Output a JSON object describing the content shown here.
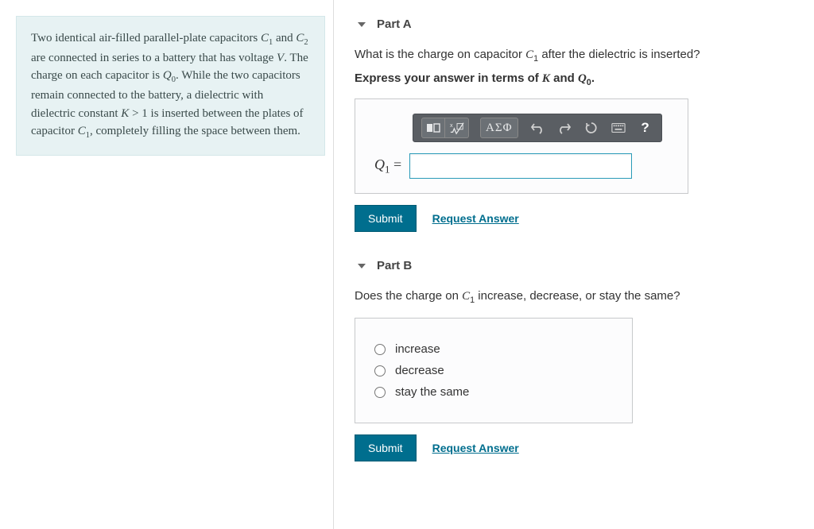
{
  "problem_html": "Two identical air-filled parallel-plate capacitors <span class='mi'>C</span><sub>1</sub> and <span class='mi'>C</span><sub>2</sub> are connected in series to a battery that has voltage <span class='mi'>V</span>. The charge on each capacitor is <span class='mi'>Q</span><sub>0</sub>. While the two capacitors remain connected to the battery, a dielectric with dielectric constant <span class='mi'>K</span> &gt; 1 is inserted between the plates of capacitor <span class='mi'>C</span><sub>1</sub>, completely filling the space between them.",
  "partA": {
    "title": "Part A",
    "question_html": "What is the charge on capacitor <span class='mi'>C</span><sub>1</sub> after the dielectric is inserted?",
    "instruction_html": "Express your answer in terms of <span class='mi'>K</span> and <span class='mi'>Q</span><sub>0</sub>.",
    "answer_label_html": "<span class='mi'>Q</span><sub>1</sub> =",
    "submit": "Submit",
    "request": "Request Answer",
    "toolbar": {
      "greek": "ΑΣΦ",
      "help": "?"
    }
  },
  "partB": {
    "title": "Part B",
    "question_html": "Does the charge on <span class='mi'>C</span><sub>1</sub> increase, decrease, or stay the same?",
    "options": [
      "increase",
      "decrease",
      "stay the same"
    ],
    "submit": "Submit",
    "request": "Request Answer"
  }
}
